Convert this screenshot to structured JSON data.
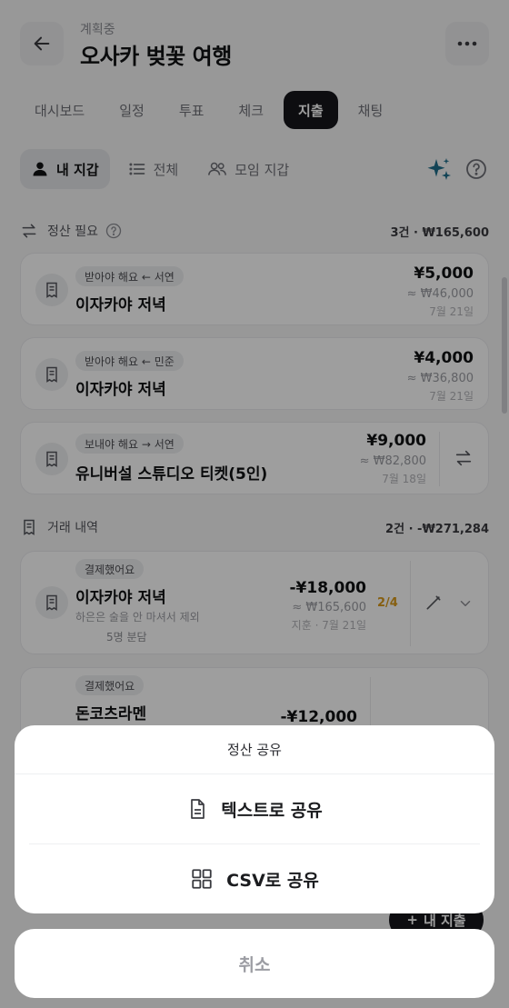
{
  "header": {
    "status": "계획중",
    "title": "오사카 벚꽃 여행"
  },
  "tabs": [
    {
      "label": "대시보드"
    },
    {
      "label": "일정"
    },
    {
      "label": "투표"
    },
    {
      "label": "체크"
    },
    {
      "label": "지출"
    },
    {
      "label": "채팅"
    }
  ],
  "subtabs": [
    {
      "label": "내 지갑"
    },
    {
      "label": "전체"
    },
    {
      "label": "모임 지갑"
    }
  ],
  "settle": {
    "title": "정산 필요",
    "summary": "3건 · ₩165,600",
    "items": [
      {
        "badge": "받아야 해요 ← 서연",
        "title": "이자카야 저녁",
        "amount": "¥5,000",
        "krw": "≈ ₩46,000",
        "date": "7월 21일"
      },
      {
        "badge": "받아야 해요 ← 민준",
        "title": "이자카야 저녁",
        "amount": "¥4,000",
        "krw": "≈ ₩36,800",
        "date": "7월 21일"
      },
      {
        "badge": "보내야 해요 → 서연",
        "title": "유니버설 스튜디오 티켓(5인)",
        "amount": "¥9,000",
        "krw": "≈ ₩82,800",
        "date": "7월 18일"
      }
    ]
  },
  "history": {
    "title": "거래 내역",
    "summary": "2건 · -₩271,284",
    "items": [
      {
        "badge": "결제했어요",
        "title": "이자카야 저녁",
        "memo": "하은은 술을 안 마셔서 제외",
        "split": "5명 분담",
        "amount": "-¥18,000",
        "krw": "≈ ₩165,600",
        "date": "지훈 · 7월 21일",
        "ratio": "2/4"
      },
      {
        "badge": "결제했어요",
        "title": "돈코츠라멘",
        "amount": "-¥12,000"
      }
    ]
  },
  "fab": {
    "label": "내 지출"
  },
  "sheet": {
    "title": "정산 공유",
    "text_option": "텍스트로 공유",
    "csv_option": "CSV로 공유",
    "cancel": "취소"
  },
  "colors": {
    "accent_dark": "#15161a",
    "ratio": "#d99a1a",
    "sparkle": "#1f6f8b"
  }
}
